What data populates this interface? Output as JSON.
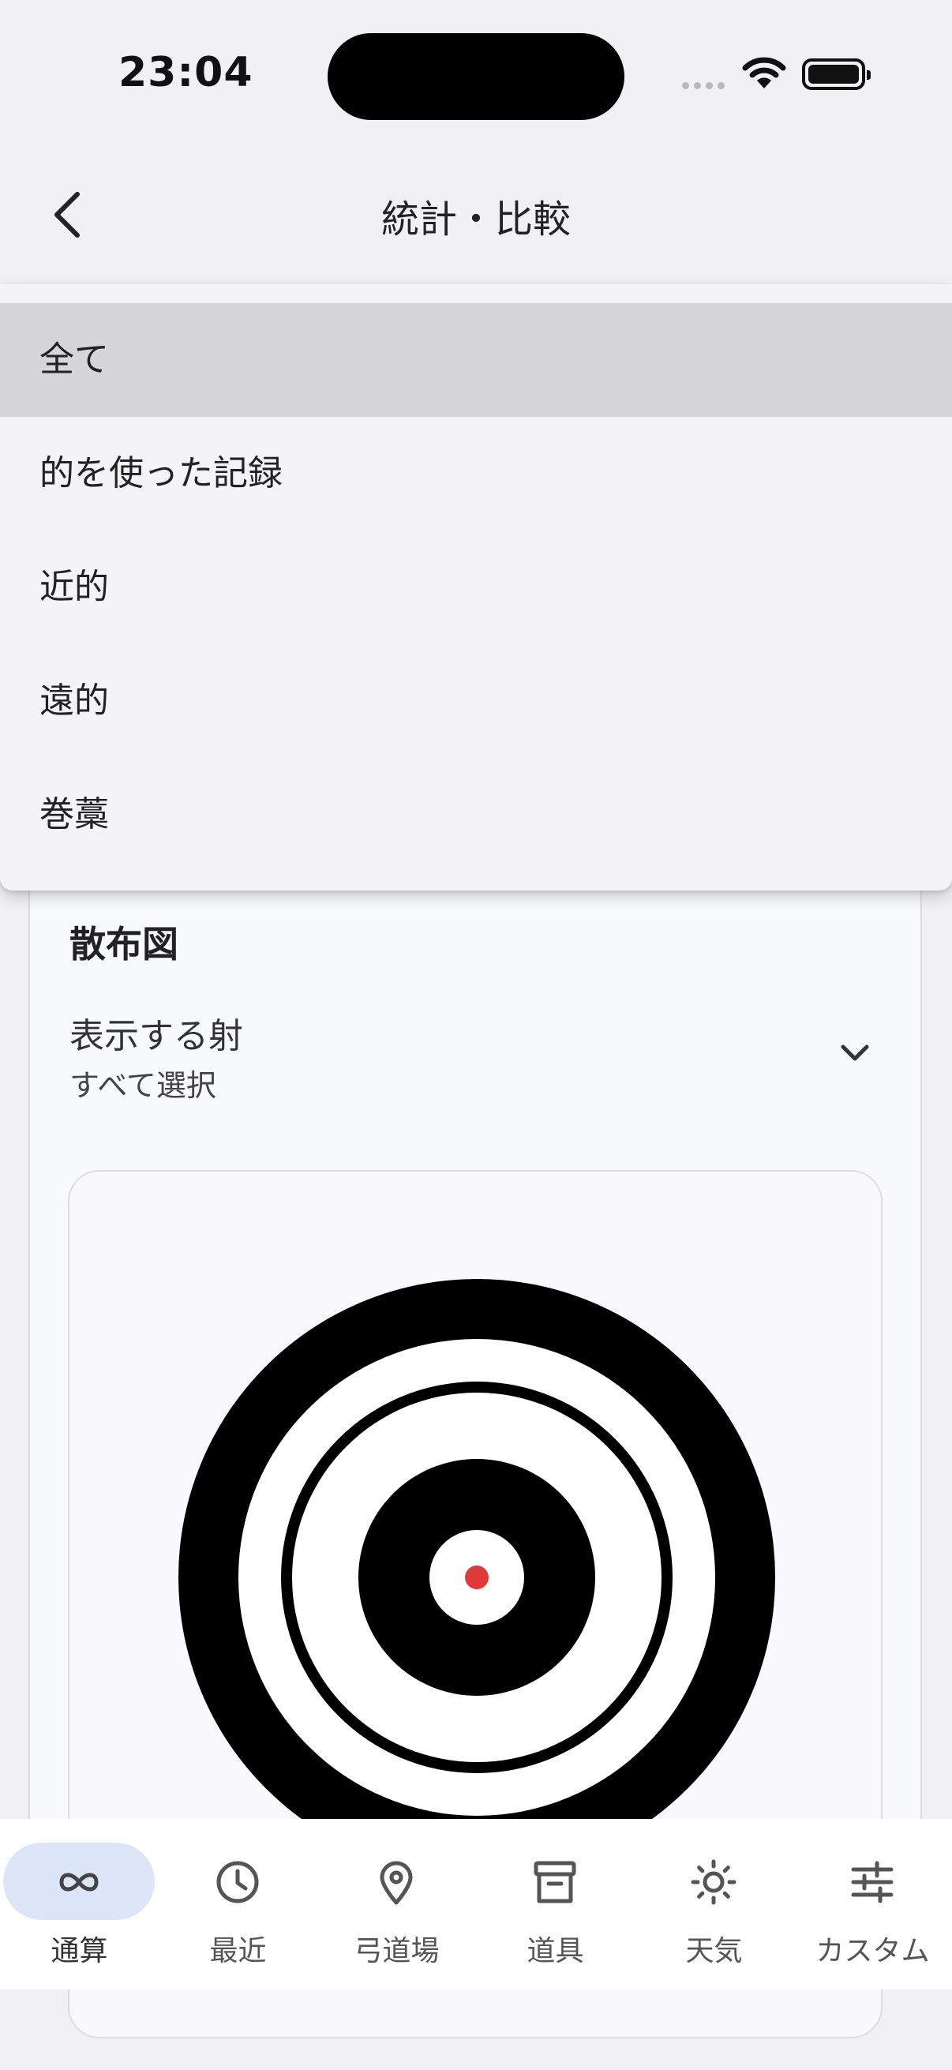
{
  "status_bar": {
    "time": "23:04"
  },
  "header": {
    "title": "統計・比較"
  },
  "dropdown": {
    "selected_index": 0,
    "options": [
      "全て",
      "的を使った記録",
      "近的",
      "遠的",
      "巻藁"
    ]
  },
  "scatter_card": {
    "title": "散布図",
    "shot_selector": {
      "label": "表示する射",
      "value": "すべて選択"
    }
  },
  "target_chart": {
    "points": [
      {
        "x": 0,
        "y": 0,
        "color": "#e03a3a"
      }
    ]
  },
  "bottom_nav": {
    "active_index": 0,
    "items": [
      {
        "label": "通算",
        "icon": "infinity-icon"
      },
      {
        "label": "最近",
        "icon": "clock-icon"
      },
      {
        "label": "弓道場",
        "icon": "location-pin-icon"
      },
      {
        "label": "道具",
        "icon": "archive-box-icon"
      },
      {
        "label": "天気",
        "icon": "sun-icon"
      },
      {
        "label": "カスタム",
        "icon": "sliders-icon"
      }
    ]
  },
  "colors": {
    "accent_pill": "#dde6f8",
    "hit_marker": "#e03a3a"
  }
}
